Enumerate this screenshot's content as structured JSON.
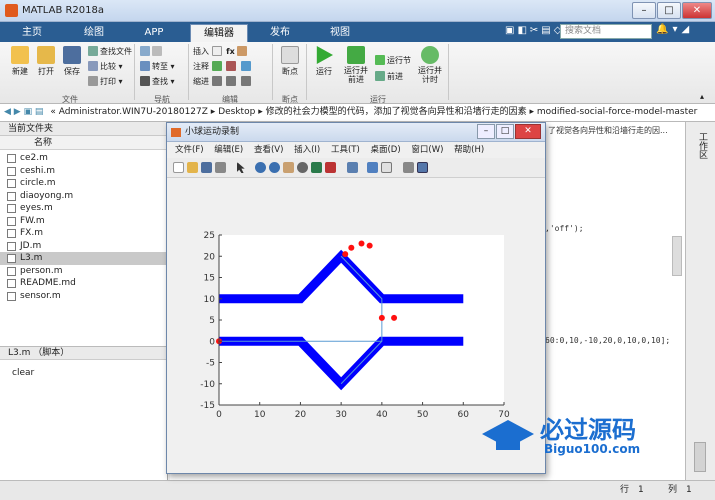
{
  "window": {
    "title": "MATLAB R2018a"
  },
  "tabs": [
    "主页",
    "绘图",
    "APP",
    "编辑器",
    "发布",
    "视图"
  ],
  "active_tab": "编辑器",
  "search": {
    "placeholder": "搜索文档"
  },
  "ribbon": {
    "file": {
      "label": "文件",
      "new": "新建",
      "open": "打开",
      "save": "保存",
      "find_files": "查找文件",
      "compare": "比较",
      "print": "打印"
    },
    "nav": {
      "label": "导航",
      "goto": "转至",
      "find": "查找"
    },
    "edit": {
      "label": "编辑",
      "insert": "插入",
      "comment": "注释",
      "indent": "缩进",
      "fx": "fx"
    },
    "breakpoints": {
      "label": "断点",
      "breakpoints": "断点"
    },
    "run": {
      "label": "运行",
      "run": "运行",
      "run_advance": "运行并\n前进",
      "run_section": "运行节",
      "advance": "前进",
      "run_time": "运行并\n计时"
    }
  },
  "path": {
    "segments": [
      "Administrator.WIN7U-20180127Z",
      "Desktop",
      "修改的社会力模型的代码，添加了视觉各向异性和沿墙行走的因素",
      "modified-social-force-model-master"
    ]
  },
  "left_panel": {
    "title": "当前文件夹",
    "column": "名称",
    "files": [
      "ce2.m",
      "ceshi.m",
      "circle.m",
      "diaoyong.m",
      "eyes.m",
      "FW.m",
      "FX.m",
      "JD.m",
      "L3.m",
      "person.m",
      "README.md",
      "sensor.m"
    ],
    "selected": "L3.m"
  },
  "details": {
    "title": "L3.m （脚本）",
    "content": "clear"
  },
  "editor": {
    "frag1": ",'off');",
    "frag2": "60:0,10,-10,20,0,10,0,10];",
    "frag3": "了视觉各向异性和沿墙行走的因..."
  },
  "right_strip": {
    "label": "工作区"
  },
  "figure": {
    "title": "小球运动录制",
    "menu": [
      "文件(F)",
      "编辑(E)",
      "查看(V)",
      "插入(I)",
      "工具(T)",
      "桌面(D)",
      "窗口(W)",
      "帮助(H)"
    ]
  },
  "chart_data": {
    "type": "line",
    "xlim": [
      0,
      70
    ],
    "ylim": [
      -15,
      25
    ],
    "xticks": [
      0,
      10,
      20,
      30,
      40,
      50,
      60,
      70
    ],
    "yticks": [
      -15,
      -10,
      -5,
      0,
      5,
      10,
      15,
      20,
      25
    ],
    "grid": false,
    "series": [
      {
        "values": [
          [
            0,
            10
          ],
          [
            20,
            10
          ],
          [
            30,
            20
          ],
          [
            40,
            10
          ],
          [
            60,
            10
          ]
        ],
        "color": "#0000ff"
      },
      {
        "values": [
          [
            0,
            0
          ],
          [
            20,
            0
          ],
          [
            30,
            -10
          ],
          [
            40,
            0
          ],
          [
            60,
            0
          ]
        ],
        "color": "#0000ff"
      },
      {
        "values": [
          [
            30,
            20
          ],
          [
            40,
            10
          ],
          [
            40,
            0
          ],
          [
            30,
            -10
          ]
        ],
        "color": "#5a9bd4",
        "thin": true
      },
      {
        "values": [
          [
            0,
            0
          ],
          [
            40,
            0
          ]
        ],
        "color": "#5a9bd4",
        "thin": true
      }
    ],
    "points": {
      "color": "#ff1010",
      "values": [
        [
          31,
          20.5
        ],
        [
          32.5,
          22
        ],
        [
          35,
          23
        ],
        [
          37,
          22.5
        ],
        [
          40,
          5.5
        ],
        [
          43,
          5.5
        ],
        [
          0,
          0
        ]
      ]
    }
  },
  "status": {
    "row_label": "行",
    "row": "1",
    "col_label": "列",
    "col": "1"
  },
  "watermark": {
    "text": "必过源码",
    "sub": "Biguo100.com"
  }
}
